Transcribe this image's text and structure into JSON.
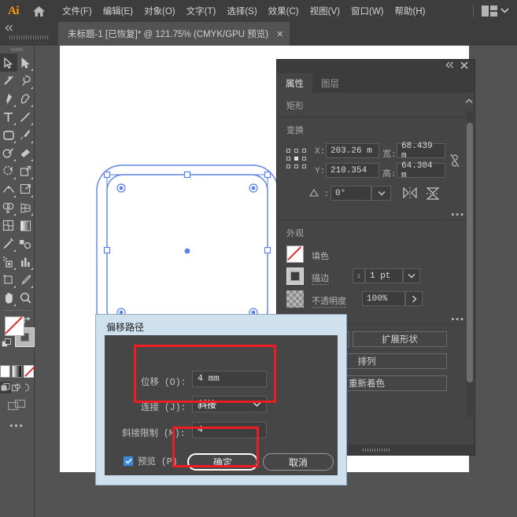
{
  "app": {
    "logo": "Ai",
    "home_icon": "home-icon",
    "workspace_icon": "workspace-layout-icon",
    "workspace_chevron": "chevron-down-icon"
  },
  "menu": {
    "items": [
      {
        "label": "文件(F)",
        "name": "menu-file"
      },
      {
        "label": "编辑(E)",
        "name": "menu-edit"
      },
      {
        "label": "对象(O)",
        "name": "menu-object"
      },
      {
        "label": "文字(T)",
        "name": "menu-type"
      },
      {
        "label": "选择(S)",
        "name": "menu-select"
      },
      {
        "label": "效果(C)",
        "name": "menu-effect"
      },
      {
        "label": "视图(V)",
        "name": "menu-view"
      },
      {
        "label": "窗口(W)",
        "name": "menu-window"
      },
      {
        "label": "帮助(H)",
        "name": "menu-help"
      }
    ]
  },
  "tabbar": {
    "collapse_icon": "collapse-left-icon",
    "document_title": "未标题-1 [已恢复]* @ 121.75% (CMYK/GPU 预览)",
    "close_label": "✕"
  },
  "toolbar": {
    "tools": [
      {
        "name": "selection-tool",
        "active": true
      },
      {
        "name": "direct-selection-tool",
        "active": false
      },
      {
        "name": "magic-wand-tool",
        "active": false
      },
      {
        "name": "lasso-tool",
        "active": false
      },
      {
        "name": "pen-tool",
        "active": false
      },
      {
        "name": "curvature-tool",
        "active": false
      },
      {
        "name": "type-tool",
        "active": false
      },
      {
        "name": "line-segment-tool",
        "active": false
      },
      {
        "name": "rectangle-tool",
        "active": false
      },
      {
        "name": "paintbrush-tool",
        "active": false
      },
      {
        "name": "shaper-tool",
        "active": false
      },
      {
        "name": "eraser-tool",
        "active": false
      },
      {
        "name": "rotate-tool",
        "active": false
      },
      {
        "name": "scale-tool",
        "active": false
      },
      {
        "name": "width-tool",
        "active": false
      },
      {
        "name": "free-transform-tool",
        "active": false
      },
      {
        "name": "shape-builder-tool",
        "active": false
      },
      {
        "name": "perspective-grid-tool",
        "active": false
      },
      {
        "name": "mesh-tool",
        "active": false
      },
      {
        "name": "gradient-tool",
        "active": false
      },
      {
        "name": "eyedropper-tool",
        "active": false
      },
      {
        "name": "blend-tool",
        "active": false
      },
      {
        "name": "symbol-sprayer-tool",
        "active": false
      },
      {
        "name": "column-graph-tool",
        "active": false
      },
      {
        "name": "artboard-tool",
        "active": false
      },
      {
        "name": "slice-tool",
        "active": false
      },
      {
        "name": "hand-tool",
        "active": false
      },
      {
        "name": "zoom-tool",
        "active": false
      }
    ],
    "fill_swatch": "fill-none-swatch",
    "stroke_swatch": "stroke-swatch",
    "swap_icon": "swap-fill-stroke-icon",
    "default_icon": "default-fill-stroke-icon",
    "color_modes": [
      "color-mode-solid",
      "color-mode-gradient",
      "color-mode-none"
    ],
    "draw_modes": [
      "draw-normal",
      "draw-behind",
      "draw-inside"
    ],
    "screen_mode": "screen-mode-icon",
    "more_tools": "•••"
  },
  "properties_panel": {
    "collapse_icon": "collapse-panel-icon",
    "close_icon": "close-panel-icon",
    "tabs": [
      {
        "label": "属性",
        "name": "tab-properties",
        "active": true
      },
      {
        "label": "图层",
        "name": "tab-layers",
        "active": false
      }
    ],
    "object_type": "矩形",
    "transform": {
      "title": "变换",
      "reference_point": "reference-point-center",
      "x_label": "X:",
      "x_value": "203.26 m",
      "y_label": "Y:",
      "y_value": "210.354",
      "w_label": "宽:",
      "w_value": "68.439 m",
      "h_label": "高:",
      "h_value": "64.304 m",
      "link_icon": "link-proportions-broken-icon",
      "angle_label": "△:",
      "angle_value": "0°",
      "angle_dropdown": "chevron-down-icon",
      "flip_h_icon": "flip-horizontal-icon",
      "flip_v_icon": "flip-vertical-icon",
      "more": "•••"
    },
    "appearance": {
      "title": "外观",
      "fill_label": "填色",
      "fill_swatch": "fill-none-swatch",
      "stroke_label": "描边",
      "stroke_swatch": "stroke-black-swatch",
      "stroke_weight": "1 pt",
      "stroke_stepper": "stepper-icon",
      "stroke_dropdown": "chevron-down-icon",
      "opacity_label": "不透明度",
      "opacity_swatch": "transparency-grid-swatch",
      "opacity_value": "100%",
      "opacity_arrow": "chevron-right-icon",
      "more": "•••"
    },
    "quick_actions": {
      "expand_shape": "扩展形状",
      "arrange": "排列",
      "recolor": "重新着色"
    },
    "scrollbar": "panel-scrollbar"
  },
  "dialog": {
    "title": "偏移路径",
    "offset_label": "位移 (O):",
    "offset_value": "4 mm",
    "join_label": "连接 (J):",
    "join_value": "斜接",
    "join_dropdown": "chevron-down-icon",
    "miter_label": "斜接限制 (M):",
    "miter_value": "4",
    "preview_label": "预览 (P)",
    "preview_checked": true,
    "ok_label": "确定",
    "cancel_label": "取消"
  },
  "annotations": {
    "highlight_color": "#ed1c24",
    "boxes": [
      "offset-and-join-highlight",
      "ok-button-highlight"
    ]
  },
  "canvas": {
    "selection_color": "#4a72e8",
    "artboard_fill": "#ffffff",
    "shape": "rounded-rectangle-with-offset-preview"
  }
}
